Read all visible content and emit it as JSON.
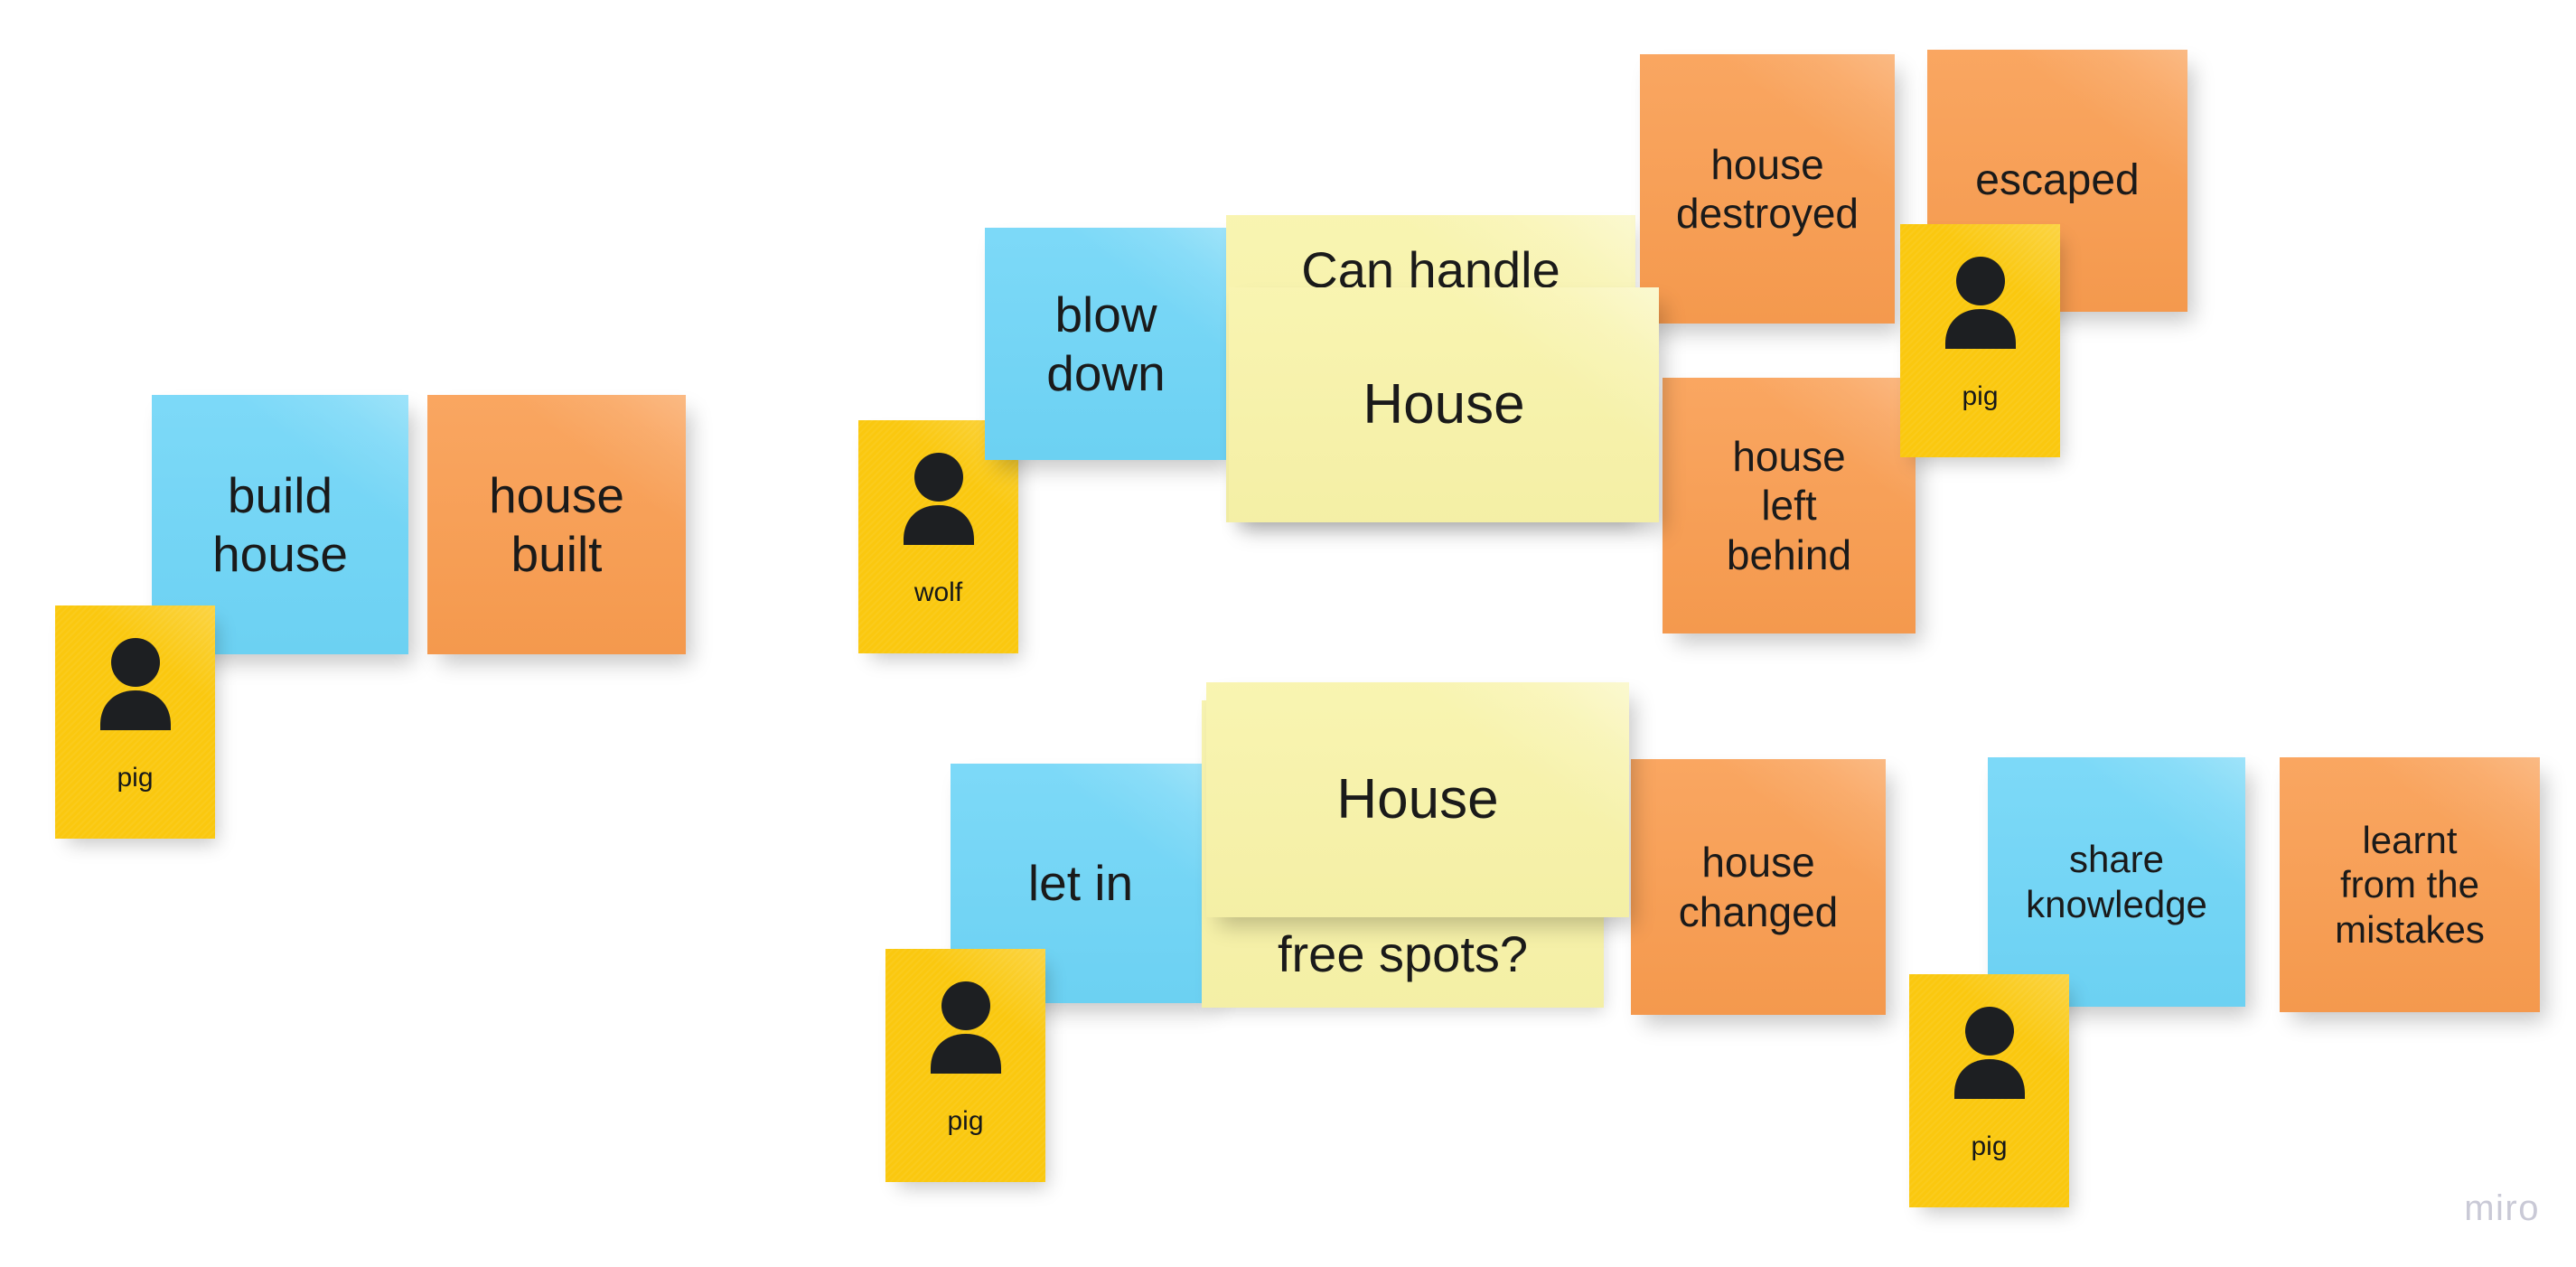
{
  "board": {
    "background_color": "#ffffff",
    "watermark": "miro"
  },
  "colors": {
    "blue": "#6ed5f7",
    "orange": "#f99c4f",
    "yellow": "#f8f3a8",
    "avatar_yellow": "#fac80f",
    "text": "#1a1a1a",
    "watermark": "#c9c9d6"
  },
  "clusters": [
    {
      "name": "build-house-cluster",
      "notes": [
        {
          "id": "build-house",
          "text": "build\nhouse",
          "color": "blue"
        },
        {
          "id": "house-built",
          "text": "house\nbuilt",
          "color": "orange"
        }
      ],
      "avatars": [
        {
          "id": "pig-1",
          "role": "pig",
          "icon": "person-icon"
        }
      ]
    },
    {
      "name": "blow-down-cluster",
      "notes": [
        {
          "id": "blow-down",
          "text": "blow\ndown",
          "color": "blue"
        },
        {
          "id": "can-handle-this",
          "text": "Can handle\nthis?",
          "color": "yellow"
        },
        {
          "id": "house-1",
          "text": "House",
          "color": "yellow"
        },
        {
          "id": "house-destroyed",
          "text": "house\ndestroyed",
          "color": "orange"
        },
        {
          "id": "escaped",
          "text": "escaped",
          "color": "orange"
        },
        {
          "id": "house-left-behind",
          "text": "house\nleft\nbehind",
          "color": "orange"
        }
      ],
      "avatars": [
        {
          "id": "wolf-1",
          "role": "wolf",
          "icon": "person-icon"
        },
        {
          "id": "pig-2",
          "role": "pig",
          "icon": "person-icon"
        }
      ]
    },
    {
      "name": "let-in-cluster",
      "notes": [
        {
          "id": "let-in",
          "text": "let in",
          "color": "blue"
        },
        {
          "id": "are-there-free-spots",
          "text": "Are there\nfree spots?",
          "color": "yellow"
        },
        {
          "id": "house-2",
          "text": "House",
          "color": "yellow"
        },
        {
          "id": "house-changed",
          "text": "house\nchanged",
          "color": "orange"
        },
        {
          "id": "share-knowledge",
          "text": "share\nknowledge",
          "color": "blue"
        },
        {
          "id": "learnt-from-mistakes",
          "text": "learnt\nfrom the\nmistakes",
          "color": "orange"
        }
      ],
      "avatars": [
        {
          "id": "pig-3",
          "role": "pig",
          "icon": "person-icon"
        },
        {
          "id": "pig-4",
          "role": "pig",
          "icon": "person-icon"
        }
      ]
    }
  ],
  "notes": {
    "build_house": "build\nhouse",
    "house_built": "house\nbuilt",
    "blow_down": "blow\ndown",
    "can_handle_this": "Can handle\nthis?",
    "house_top": "House",
    "house_destroyed": "house\ndestroyed",
    "escaped": "escaped",
    "house_left_behind": "house\nleft\nbehind",
    "let_in": "let in",
    "are_there_free_spots": "Are there\nfree spots?",
    "house_bottom": "House",
    "house_changed": "house\nchanged",
    "share_knowledge": "share\nknowledge",
    "learnt_from_mistakes": "learnt\nfrom the\nmistakes"
  },
  "avatars": {
    "pig_1": "pig",
    "wolf_1": "wolf",
    "pig_2": "pig",
    "pig_3": "pig",
    "pig_4": "pig"
  }
}
